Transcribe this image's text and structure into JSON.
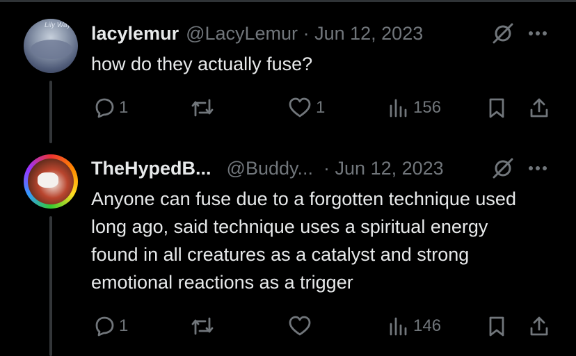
{
  "tweets": [
    {
      "display_name": "lacylemur",
      "handle": "@LacyLemur",
      "separator": "·",
      "date": "Jun 12, 2023",
      "avatar_text": "Lily Way",
      "text": "how do they actually fuse?",
      "replies": "1",
      "reposts": "",
      "likes": "1",
      "views": "156"
    },
    {
      "display_name": "TheHypedB...",
      "handle": "@Buddy...",
      "separator": "·",
      "date": "Jun 12, 2023",
      "avatar_text": "",
      "text": "Anyone can fuse due to a forgotten technique used long ago, said technique uses a spiritual energy found in all creatures as a catalyst and strong emotional reactions as a trigger",
      "replies": "1",
      "reposts": "",
      "likes": "",
      "views": "146"
    }
  ],
  "icons": [
    "reply-icon",
    "repost-icon",
    "like-icon",
    "views-icon",
    "bookmark-icon",
    "share-icon",
    "grok-icon",
    "more-icon"
  ],
  "colors": {
    "background": "#000000",
    "text": "#e7e9ea",
    "muted": "#71767b",
    "divider": "#2f3336"
  }
}
